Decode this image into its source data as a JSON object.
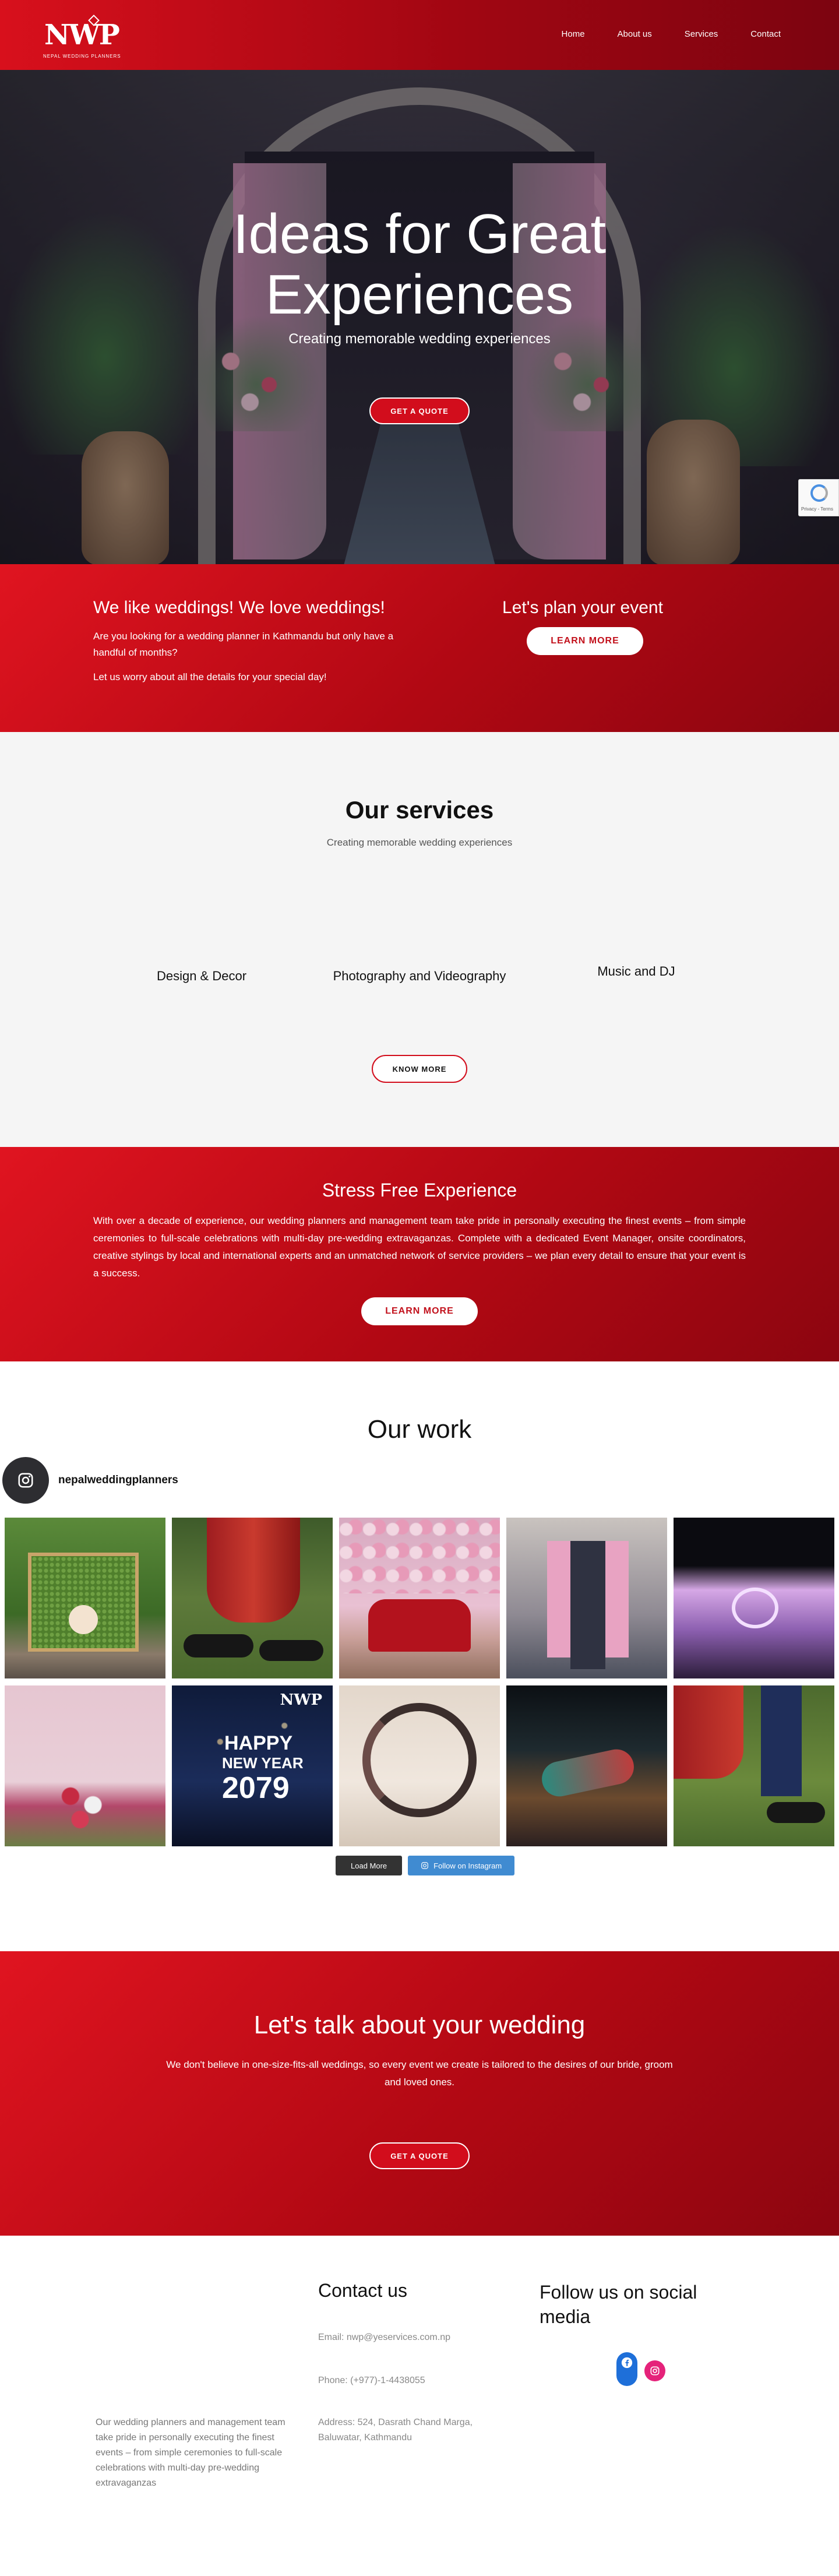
{
  "brand": {
    "logo_text": "NWP",
    "logo_sub": "NEPAL WEDDING PLANNERS"
  },
  "nav": {
    "items": [
      "Home",
      "About us",
      "Services",
      "Contact"
    ]
  },
  "hero": {
    "title_line1": "Ideas for Great",
    "title_line2": "Experiences",
    "subtitle": "Creating memorable wedding experiences",
    "cta": "GET A QUOTE"
  },
  "recaptcha": {
    "text": "Privacy - Terms"
  },
  "love": {
    "title": "We like weddings! We love weddings!",
    "p1": "Are you looking for a wedding planner in Kathmandu but only have a handful of months?",
    "p2": "Let us worry about all the details for your special day!",
    "plan_title": "Let's plan your event",
    "cta": "LEARN MORE"
  },
  "services": {
    "title": "Our services",
    "subtitle": "Creating memorable wedding experiences",
    "items": [
      "Design & Decor",
      "Photography and Videography",
      "Music and DJ"
    ],
    "cta": "KNOW MORE"
  },
  "stress": {
    "title": "Stress Free Experience",
    "paragraph": "With over a decade of experience, our wedding planners and management team take pride in personally executing the finest events – from simple ceremonies to full-scale celebrations with multi-day pre-wedding extravaganzas. Complete with a dedicated Event Manager, onsite coordinators, creative stylings by local and international experts and an unmatched network of service providers – we plan every detail to ensure that your event is a success.",
    "cta": "LEARN MORE"
  },
  "work": {
    "title": "Our work",
    "ig_username": "nepalweddingplanners",
    "tiles": [
      "green-wall-decor",
      "groom-shoes",
      "red-sofa-stage",
      "pink-curtain-entrance",
      "lit-stage-hall",
      "pink-floral-board",
      "happy-new-year-card",
      "floral-ring-arch",
      "dancers-performance",
      "couple-feet"
    ],
    "card_logo": "NWP",
    "card_line1": "HAPPY",
    "card_line2": "NEW YEAR",
    "card_line3": "2079",
    "load_more": "Load More",
    "follow_instagram": "Follow on Instagram"
  },
  "talk": {
    "title": "Let's talk about your wedding",
    "paragraph": "We don't believe in one-size-fits-all weddings, so every event we create is tailored to the desires of our bride, groom and loved ones.",
    "cta": "GET A QUOTE"
  },
  "footer": {
    "about": "Our wedding planners and management team take pride in personally executing the finest events – from simple ceremonies to full-scale celebrations with multi-day pre-wedding extravaganzas",
    "contact_title": "Contact us",
    "email": "Email: nwp@yeservices.com.np",
    "phone": "Phone: (+977)-1-4438055",
    "address": "Address: 524, Dasrath Chand Marga, Baluwatar, Kathmandu",
    "follow_title": "Follow us on social media"
  },
  "colors": {
    "brand_red": "#d20d1c",
    "dark_red": "#8c0510",
    "instagram_blue": "#408bd1",
    "facebook_blue": "#1e6fd9",
    "instagram_pink": "#e5227a"
  }
}
